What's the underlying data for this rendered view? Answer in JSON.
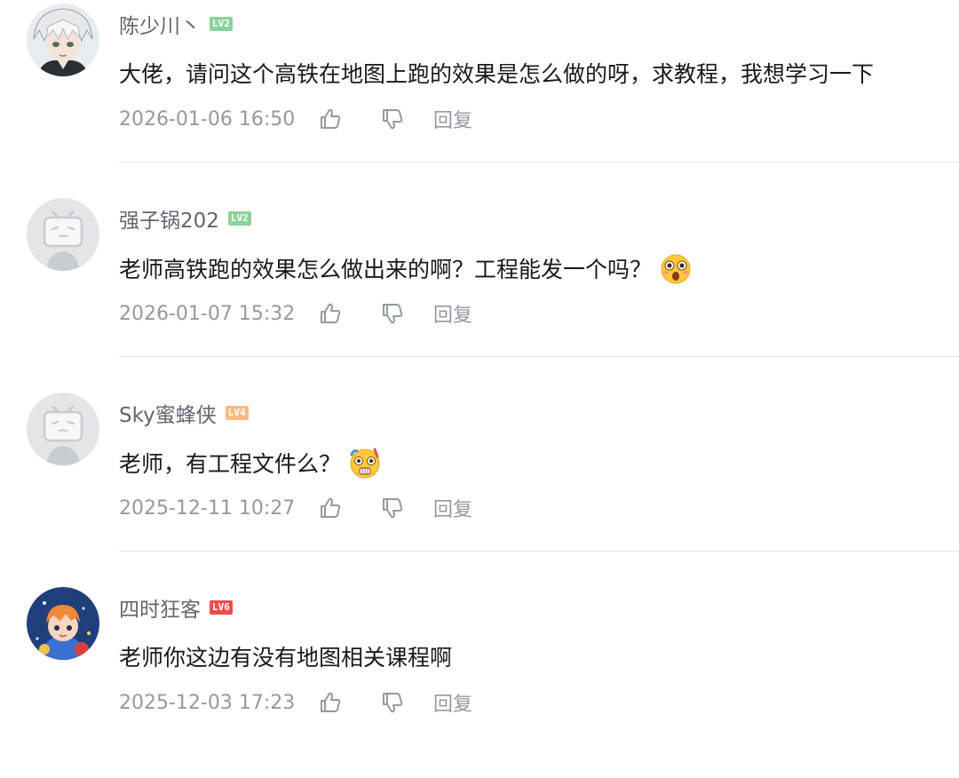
{
  "comments": [
    {
      "username": "陈少川丶",
      "level": "LV2",
      "level_color": "#8bd29b",
      "text": "大佬，请问这个高铁在地图上跑的效果是怎么做的呀，求教程，我想学习一下",
      "emoji": "",
      "time": "2026-01-06 16:50",
      "avatar": "anime-avatar-white-hair"
    },
    {
      "username": "强子锅202",
      "level": "LV2",
      "level_color": "#8bd29b",
      "text": "老师高铁跑的效果怎么做出来的啊？工程能发一个吗？",
      "emoji": "shocked-emoji",
      "time": "2026-01-07 15:32",
      "avatar": "default-tv-avatar"
    },
    {
      "username": "Sky蜜蜂侠",
      "level": "LV4",
      "level_color": "#feba82",
      "text": "老师，有工程文件么？",
      "emoji": "scared-emoji",
      "time": "2025-12-11 10:27",
      "avatar": "default-tv-avatar"
    },
    {
      "username": "四时狂客",
      "level": "LV6",
      "level_color": "#f04c49",
      "text": "老师你这边有没有地图相关课程啊",
      "emoji": "",
      "time": "2025-12-03 17:23",
      "avatar": "anime-avatar-colorful"
    }
  ],
  "actions": {
    "reply_label": "回复"
  }
}
